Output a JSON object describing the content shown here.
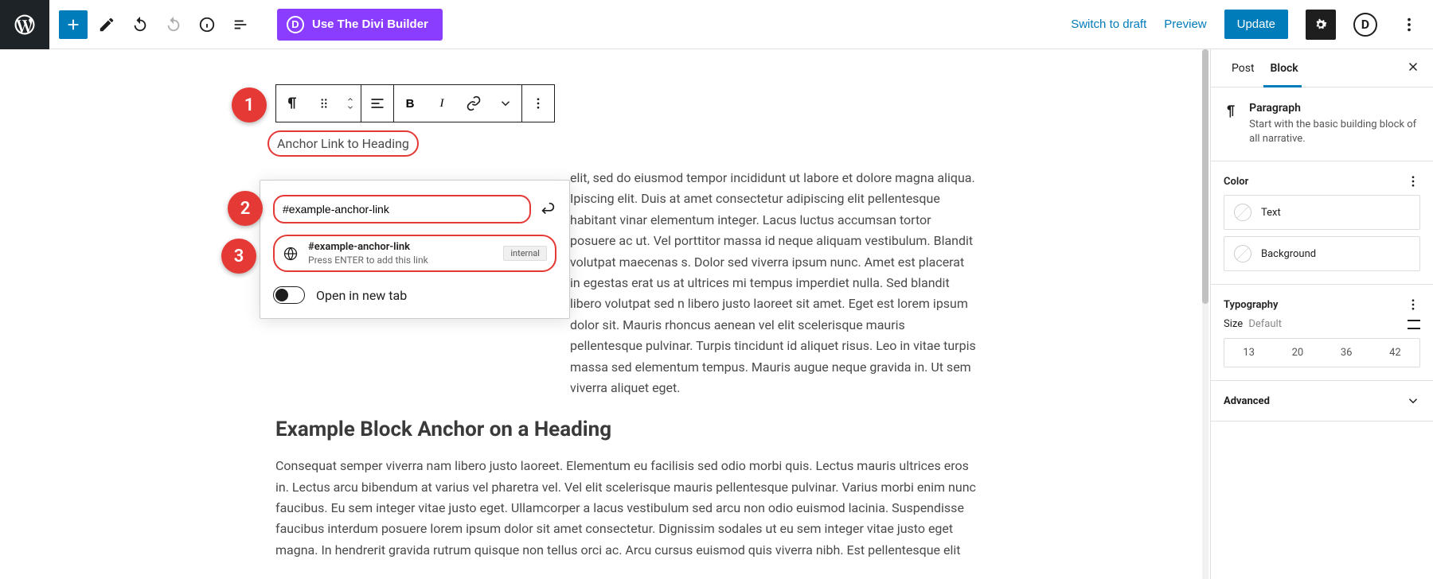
{
  "topbar": {
    "divi_label": "Use The Divi Builder",
    "switch_draft": "Switch to draft",
    "preview": "Preview",
    "update": "Update"
  },
  "sidebar": {
    "tab_post": "Post",
    "tab_block": "Block",
    "block_title": "Paragraph",
    "block_desc": "Start with the basic building block of all narrative.",
    "section_color": "Color",
    "color_text": "Text",
    "color_background": "Background",
    "section_typo": "Typography",
    "size_label": "Size",
    "size_default": "Default",
    "sizes": [
      "13",
      "20",
      "36",
      "42"
    ],
    "section_advanced": "Advanced"
  },
  "editor": {
    "selected_text": "Anchor Link to Heading",
    "paragraph": "elit, sed do eiusmod tempor incididunt ut labore et dolore magna aliqua. Ipiscing elit. Duis at amet consectetur adipiscing elit pellentesque habitant vinar elementum integer. Lacus luctus accumsan tortor posuere ac ut. Vel porttitor massa id neque aliquam vestibulum. Blandit volutpat maecenas s. Dolor sed viverra ipsum nunc. Amet est placerat in egestas erat us at ultrices mi tempus imperdiet nulla. Sed blandit libero volutpat sed n libero justo laoreet sit amet. Eget est lorem ipsum dolor sit. Mauris rhoncus aenean vel elit scelerisque mauris pellentesque pulvinar. Turpis tincidunt id aliquet risus. Leo in vitae turpis massa sed elementum tempus. Mauris augue neque gravida in. Ut sem viverra aliquet eget.",
    "heading": "Example Block Anchor on a Heading",
    "paragraph2": "Consequat semper viverra nam libero justo laoreet. Elementum eu facilisis sed odio morbi quis. Lectus mauris ultrices eros in. Lectus arcu bibendum at varius vel pharetra vel. Vel elit scelerisque mauris pellentesque pulvinar. Varius morbi enim nunc faucibus. Eu sem integer vitae justo eget. Ullamcorper a lacus vestibulum sed arcu non odio euismod lacinia. Suspendisse faucibus interdum posuere lorem ipsum dolor sit amet consectetur. Dignissim sodales ut eu sem integer vitae justo eget magna. In hendrerit gravida rutrum quisque non tellus orci ac. Arcu cursus euismod quis viverra nibh. Est pellentesque elit"
  },
  "link_popover": {
    "input_value": "#example-anchor-link",
    "suggestion_title": "#example-anchor-link",
    "suggestion_hint": "Press ENTER to add this link",
    "suggestion_badge": "internal",
    "open_new_tab": "Open in new tab"
  },
  "callouts": [
    "1",
    "2",
    "3"
  ]
}
